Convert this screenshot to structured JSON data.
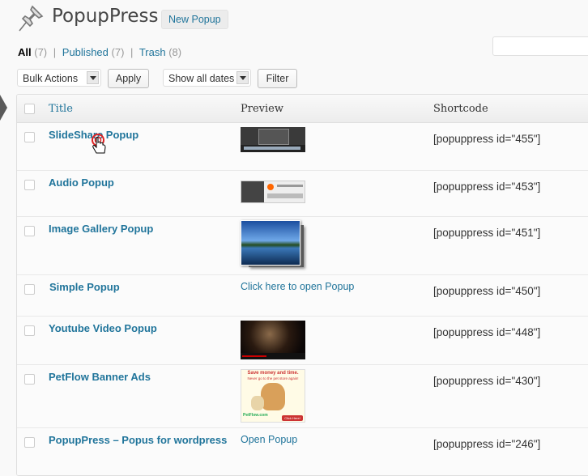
{
  "header": {
    "title": "PopupPress",
    "add_new": "New Popup",
    "pin_icon": "pushpin-icon"
  },
  "filters": {
    "all_label": "All",
    "all_count": "(7)",
    "published_label": "Published",
    "published_count": "(7)",
    "trash_label": "Trash",
    "trash_count": "(8)",
    "separator": "|"
  },
  "toolbar": {
    "bulk_actions": "Bulk Actions",
    "apply": "Apply",
    "dates": "Show all dates",
    "filter": "Filter"
  },
  "table": {
    "columns": [
      "Title",
      "Preview",
      "Shortcode"
    ],
    "rows": [
      {
        "title": "SlideShare Popup",
        "preview": "",
        "preview_kind": "slideshare-thumbnail",
        "shortcode": "[popuppress id=\"455\"]"
      },
      {
        "title": "Audio Popup",
        "preview": "",
        "preview_kind": "audio-player-thumbnail",
        "shortcode": "[popuppress id=\"453\"]"
      },
      {
        "title": "Image Gallery Popup",
        "preview": "",
        "preview_kind": "landscape-gallery-thumbnail",
        "shortcode": "[popuppress id=\"451\"]"
      },
      {
        "title": "Simple Popup",
        "preview": "Click here to open Popup",
        "preview_kind": "link",
        "shortcode": "[popuppress id=\"450\"]"
      },
      {
        "title": "Youtube Video Popup",
        "preview": "",
        "preview_kind": "video-thumbnail",
        "shortcode": "[popuppress id=\"448\"]"
      },
      {
        "title": "PetFlow Banner Ads",
        "preview": "",
        "preview_kind": "petflow-banner-thumbnail",
        "shortcode": "[popuppress id=\"430\"]"
      },
      {
        "title": "PopupPress – Popus for wordpress",
        "preview": "Open Popup",
        "preview_kind": "link",
        "shortcode": "[popuppress id=\"246\"]"
      }
    ]
  },
  "banner": {
    "headline": "Save money and time.",
    "sub": "Never go to the pet store again!",
    "brand": "PetFlow.com",
    "cta": "Click Here!"
  },
  "colors": {
    "link": "#21759b",
    "background": "#f9f9f9"
  }
}
